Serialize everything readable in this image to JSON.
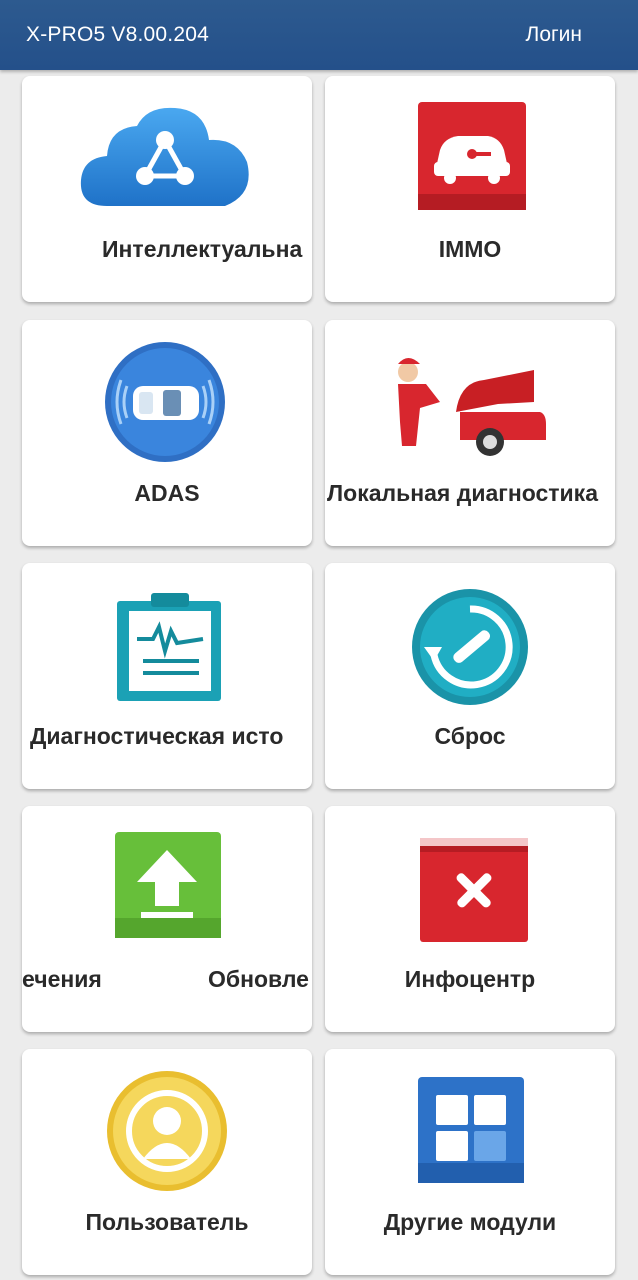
{
  "header": {
    "title": "X-PRO5 V8.00.204",
    "login": "Логин"
  },
  "tiles": [
    {
      "label": "Интеллектуальна",
      "icon": "cloud-share-icon"
    },
    {
      "label": "IMMO",
      "icon": "car-key-icon"
    },
    {
      "label": "ADAS",
      "icon": "car-sensor-icon"
    },
    {
      "label": "Локальная диагностика",
      "icon": "mechanic-car-icon"
    },
    {
      "label": "Диагностическая исто",
      "icon": "clipboard-waveform-icon"
    },
    {
      "label": "Сброс",
      "icon": "reset-wrench-icon"
    },
    {
      "label_a": "ечения",
      "label_b": "Обновле",
      "icon": "upload-arrow-icon"
    },
    {
      "label": "Инфоцентр",
      "icon": "toolbook-icon"
    },
    {
      "label": "Пользователь",
      "icon": "user-avatar-icon"
    },
    {
      "label": "Другие модули",
      "icon": "grid-modules-icon"
    }
  ],
  "colors": {
    "header": "#2d5a8f",
    "background": "#ececec",
    "tile": "#ffffff"
  }
}
